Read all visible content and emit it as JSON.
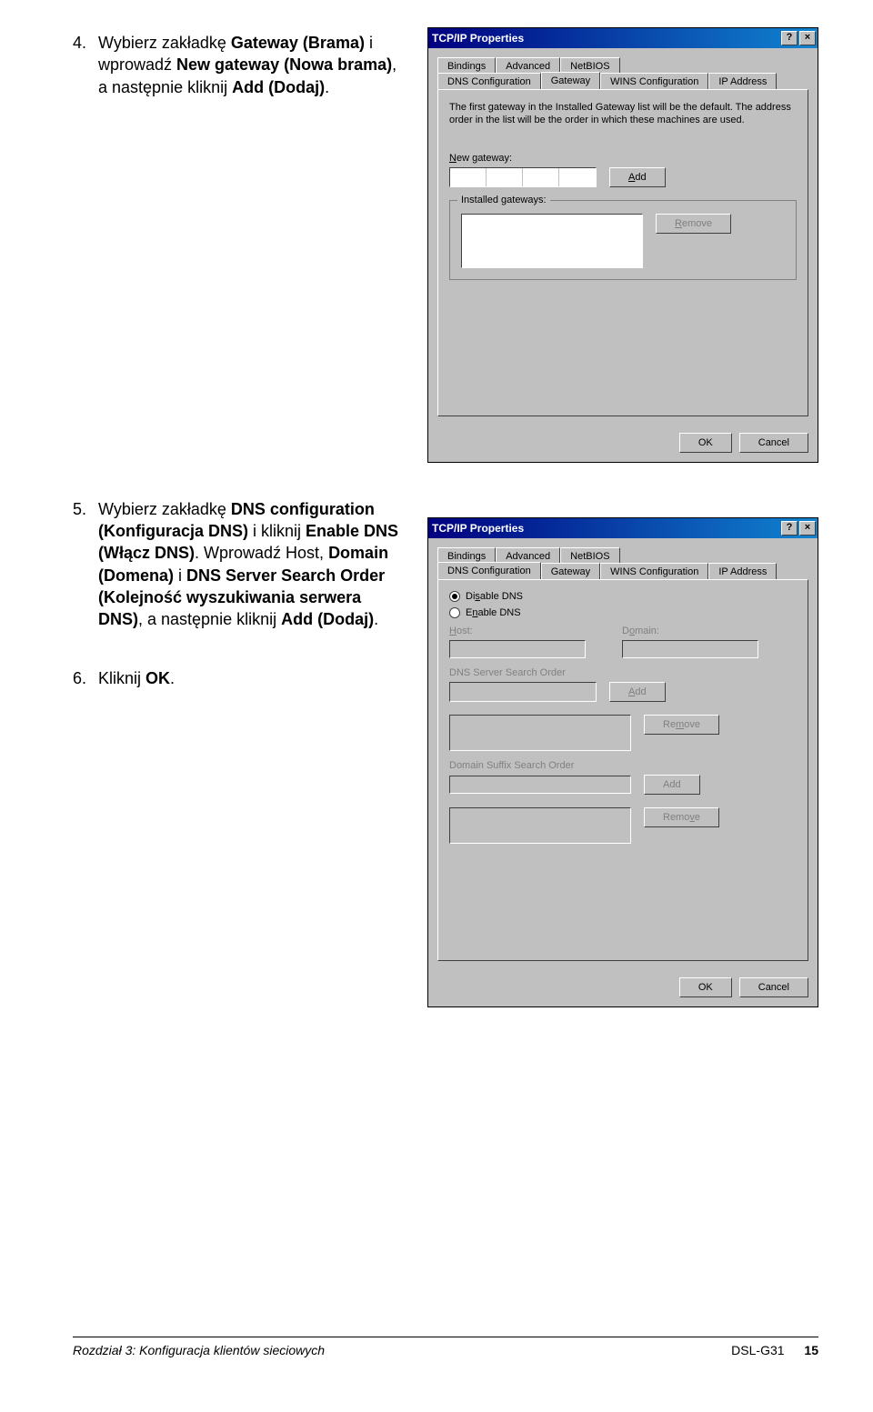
{
  "step4": {
    "num": "4.",
    "pre": "Wybierz zakładkę ",
    "b1": "Gateway (Brama)",
    "mid1": " i wprowadź ",
    "b2": "New gateway (Nowa brama)",
    "mid2": ", a następnie kliknij ",
    "b3": "Add (Dodaj)",
    "post": "."
  },
  "step5": {
    "num": "5.",
    "pre": "Wybierz zakładkę ",
    "b1": "DNS configuration (Konfiguracja DNS)",
    "mid1": " i kliknij ",
    "b2": "Enable DNS (Włącz DNS)",
    "mid2": ". Wprowadź Host, ",
    "b3": "Domain (Domena)",
    "mid3": " i ",
    "b4": "DNS Server Search Order (Kolejność wyszukiwania serwera DNS)",
    "mid4": ", a następnie kliknij ",
    "b5": "Add (Dodaj)",
    "post": "."
  },
  "step6": {
    "num": "6.",
    "pre": "Kliknij ",
    "b1": "OK",
    "post": "."
  },
  "dialog1": {
    "title": "TCP/IP Properties",
    "help_btn": "?",
    "close_btn": "×",
    "tabs_back": [
      "Bindings",
      "Advanced",
      "NetBIOS"
    ],
    "tabs_front": [
      "DNS Configuration",
      "Gateway",
      "WINS Configuration",
      "IP Address"
    ],
    "active_tab": "Gateway",
    "desc": "The first gateway in the Installed Gateway list will be the default. The address order in the list will be the order in which these machines are used.",
    "new_gateway_label_pre": "N",
    "new_gateway_label_post": "ew gateway:",
    "add_label_pre": "A",
    "add_label_post": "dd",
    "installed_label": "Installed gateways:",
    "remove_label_pre": "R",
    "remove_label_post": "emove",
    "ok": "OK",
    "cancel": "Cancel"
  },
  "dialog2": {
    "title": "TCP/IP Properties",
    "help_btn": "?",
    "close_btn": "×",
    "tabs_back": [
      "Bindings",
      "Advanced",
      "NetBIOS"
    ],
    "tabs_front": [
      "DNS Configuration",
      "Gateway",
      "WINS Configuration",
      "IP Address"
    ],
    "active_tab": "DNS Configuration",
    "disable_pre": "Di",
    "disable_key": "s",
    "disable_post": "able DNS",
    "enable_pre": "E",
    "enable_key": "n",
    "enable_post": "able DNS",
    "host_pre_key": "H",
    "host_post": "ost:",
    "domain_pre": "D",
    "domain_key": "o",
    "domain_post": "main:",
    "server_order": "DNS Server Search Order",
    "add_key": "A",
    "add_post": "dd",
    "remove_pre": "Re",
    "remove_key": "m",
    "remove_post": "ove",
    "suffix_order": "Domain Suffix Search Order",
    "add2": "Add",
    "remove2_pre": "Remo",
    "remove2_key": "v",
    "remove2_post": "e",
    "ok": "OK",
    "cancel": "Cancel"
  },
  "footer": {
    "left": "Rozdział 3: Konfiguracja klientów sieciowych",
    "model": "DSL-G31",
    "page": "15"
  }
}
